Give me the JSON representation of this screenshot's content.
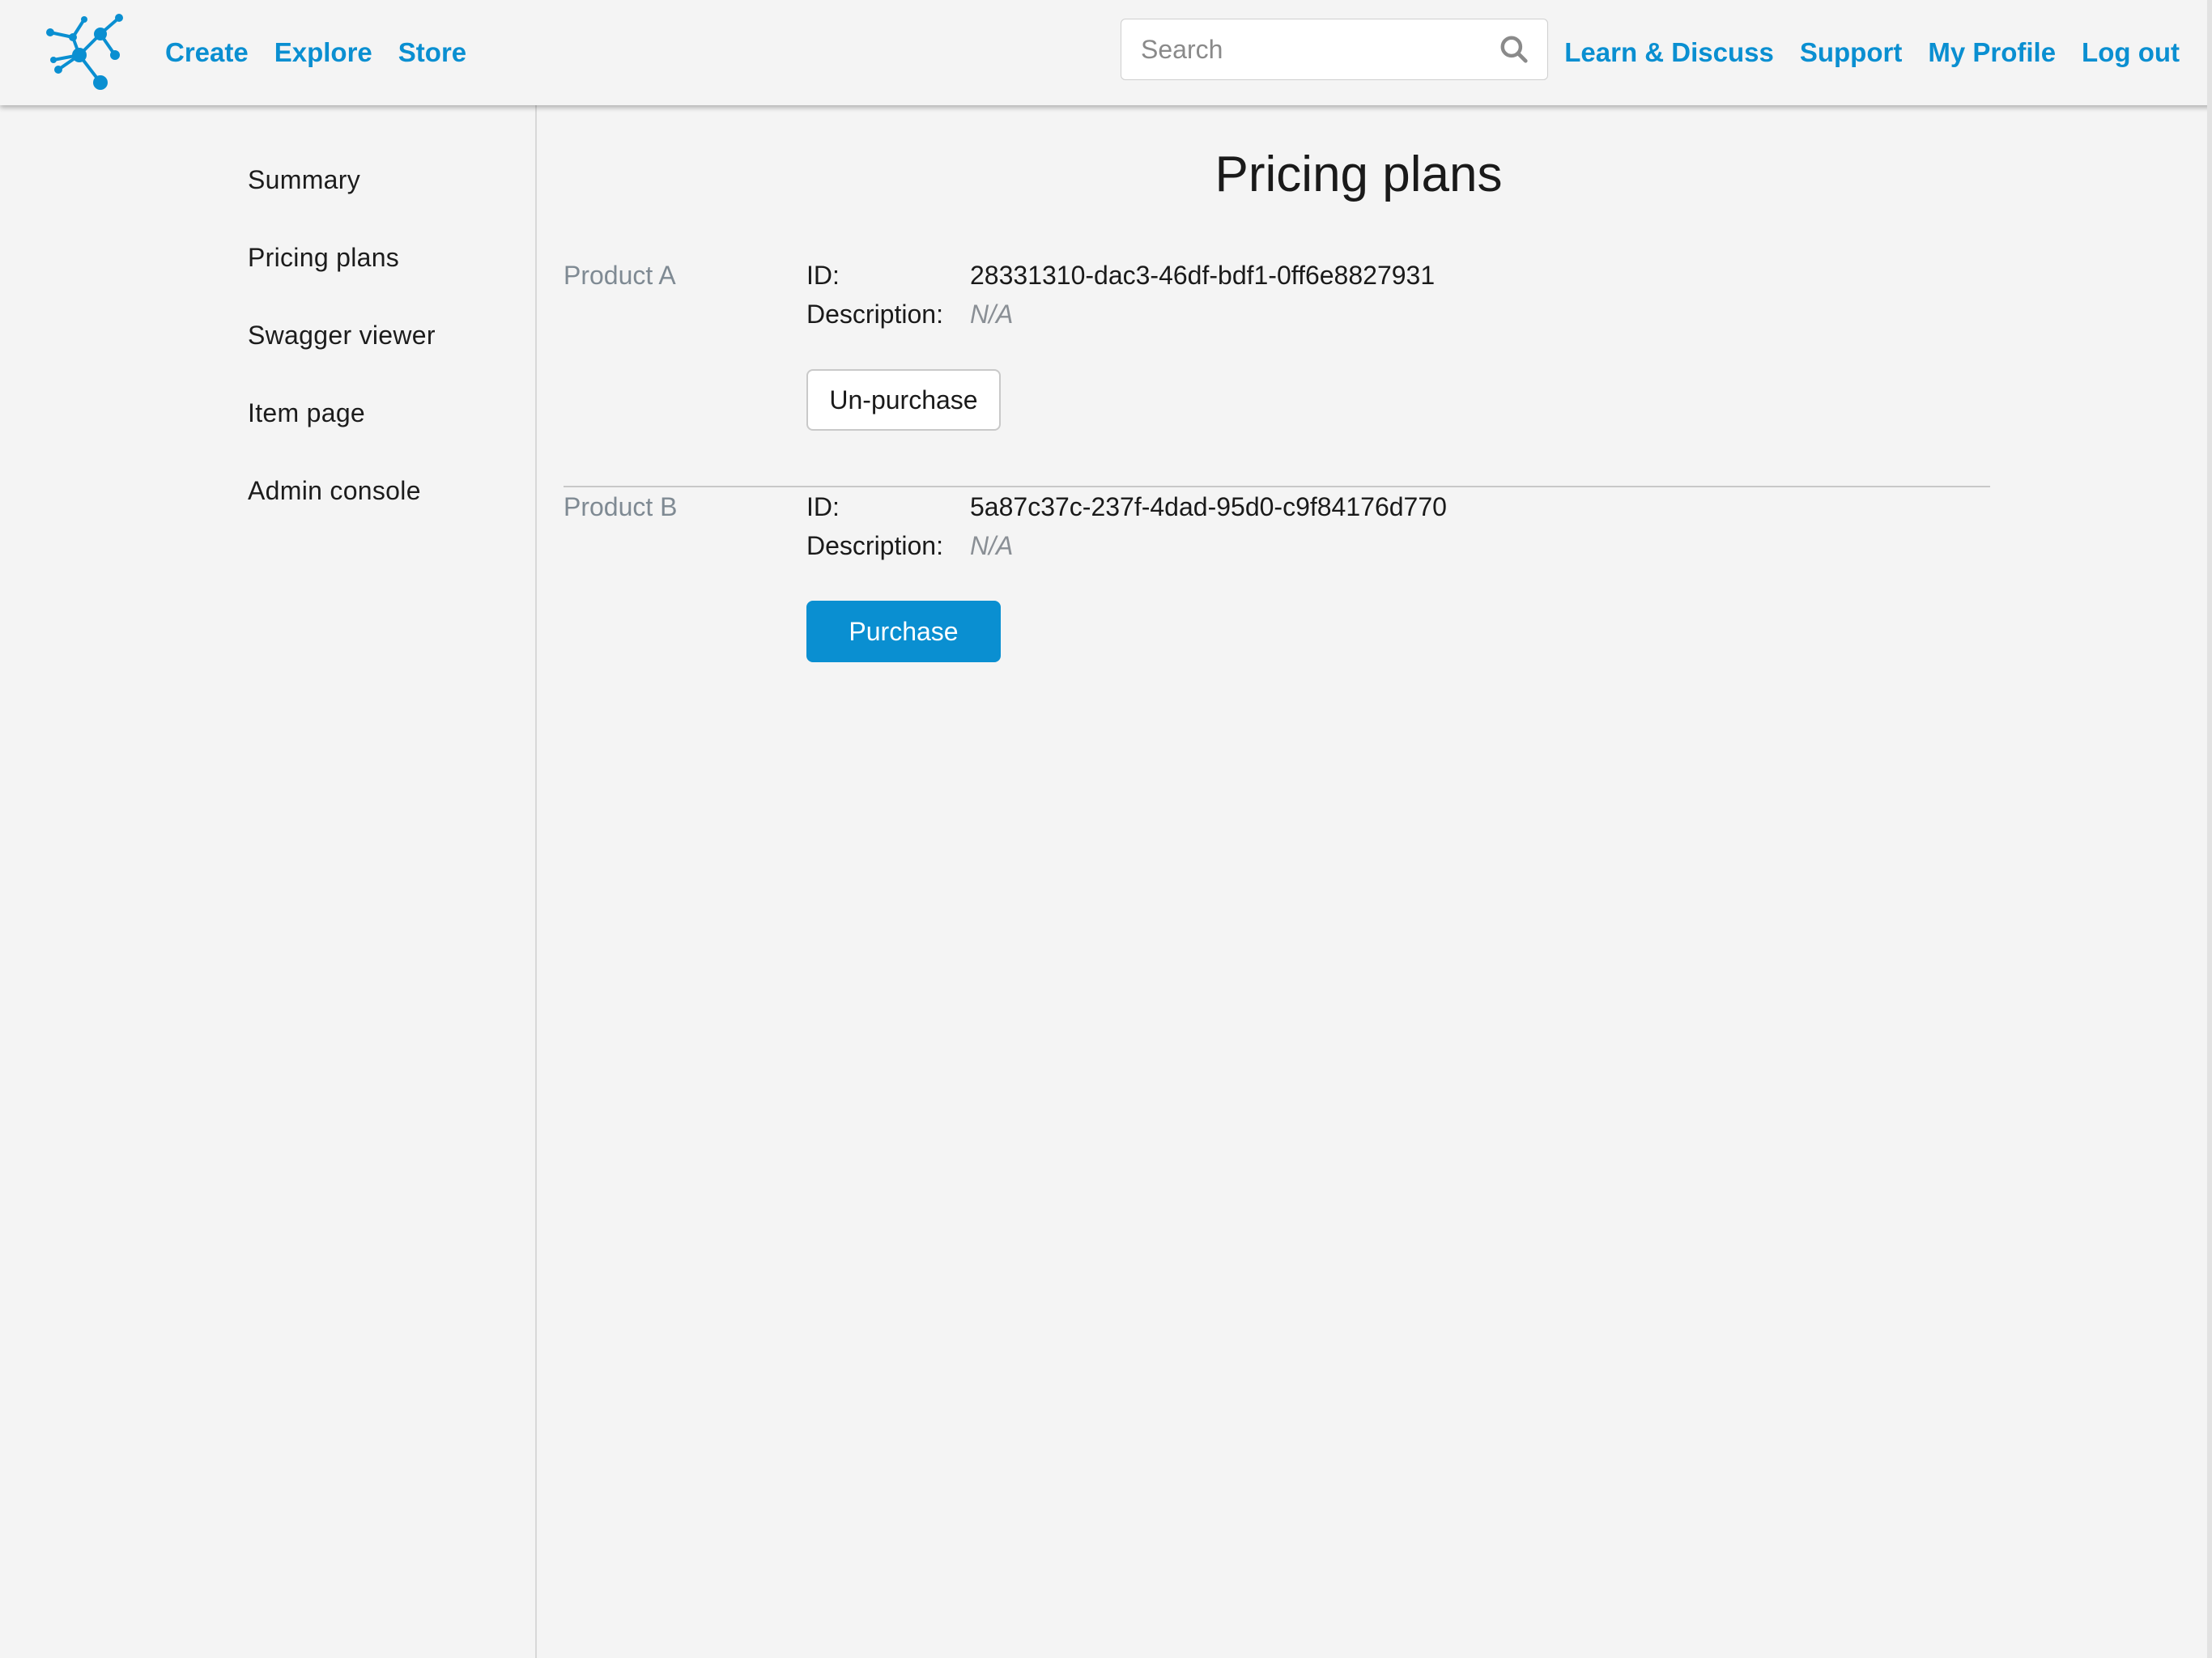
{
  "header": {
    "nav_left": [
      "Create",
      "Explore",
      "Store"
    ],
    "search": {
      "placeholder": "Search"
    },
    "nav_right": [
      "Learn & Discuss",
      "Support",
      "My Profile",
      "Log out"
    ]
  },
  "sidebar": {
    "items": [
      {
        "label": "Summary"
      },
      {
        "label": "Pricing plans"
      },
      {
        "label": "Swagger viewer"
      },
      {
        "label": "Item page"
      },
      {
        "label": "Admin console"
      }
    ]
  },
  "main": {
    "title": "Pricing plans",
    "id_label": "ID:",
    "description_label": "Description:",
    "products": [
      {
        "name": "Product A",
        "id": "28331310-dac3-46df-bdf1-0ff6e8827931",
        "description": "N/A",
        "button": "Un-purchase"
      },
      {
        "name": "Product B",
        "id": "5a87c37c-237f-4dad-95d0-c9f84176d770",
        "description": "N/A",
        "button": "Purchase"
      }
    ]
  },
  "colors": {
    "accent": "#0a8fd1",
    "background": "#f4f4f4",
    "muted_text": "#7f8a93"
  },
  "icons": [
    "network-logo-icon",
    "search-icon"
  ]
}
